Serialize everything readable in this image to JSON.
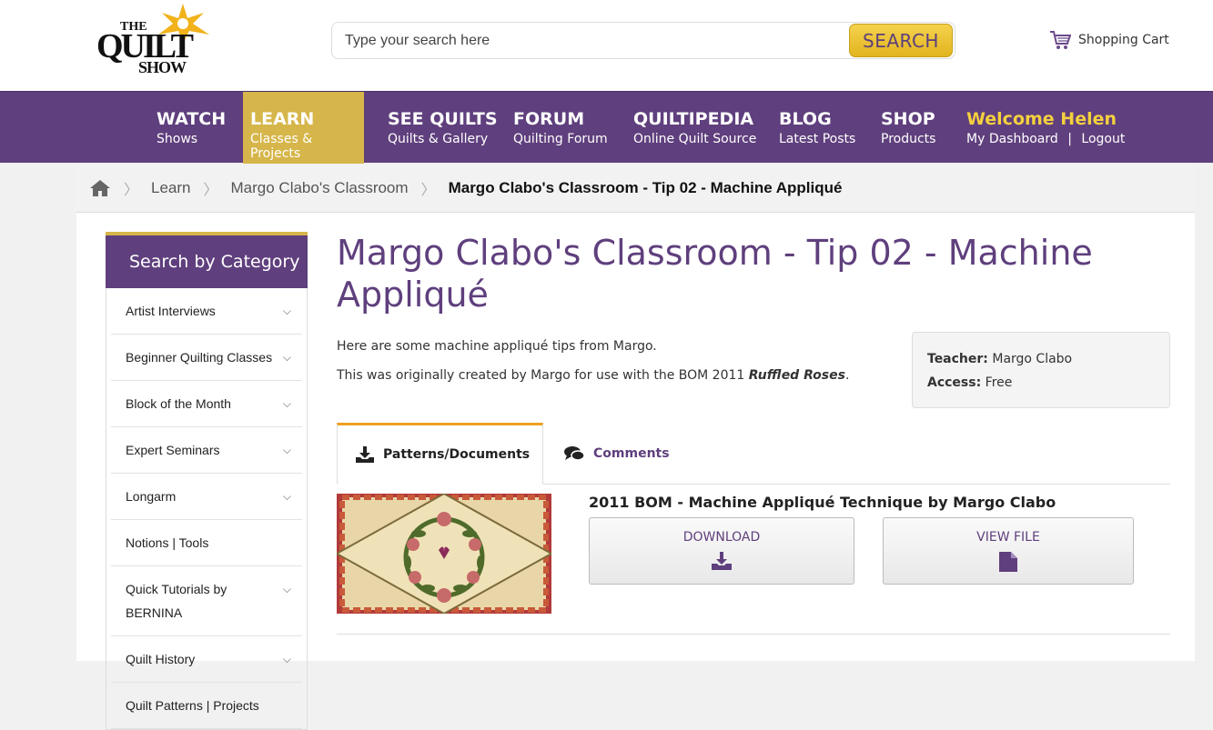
{
  "header": {
    "logo": {
      "the": "THE",
      "quilt": "QUILT",
      "show": "SHOW"
    },
    "search": {
      "placeholder": "Type your search here",
      "button": "SEARCH"
    },
    "cart_label": "Shopping Cart"
  },
  "nav": {
    "items": [
      {
        "title": "WATCH",
        "sub": "Shows"
      },
      {
        "title": "LEARN",
        "sub": "Classes & Projects"
      },
      {
        "title": "SEE QUILTS",
        "sub": "Quilts & Gallery"
      },
      {
        "title": "FORUM",
        "sub": "Quilting Forum"
      },
      {
        "title": "QUILTIPEDIA",
        "sub": "Online Quilt Source"
      },
      {
        "title": "BLOG",
        "sub": "Latest Posts"
      },
      {
        "title": "SHOP",
        "sub": "Products"
      }
    ],
    "welcome": {
      "title": "Welcome Helen",
      "dashboard": "My Dashboard",
      "separator": "|",
      "logout": "Logout"
    },
    "active_color": "#d6b64a",
    "bar_color": "#5f3f7d"
  },
  "breadcrumb": {
    "items": [
      "Learn",
      "Margo Clabo's Classroom"
    ],
    "current": "Margo Clabo's Classroom - Tip 02 - Machine Appliqué"
  },
  "sidebar": {
    "heading": "Search by Category",
    "items": [
      {
        "label": "Artist Interviews",
        "expandable": true
      },
      {
        "label": "Beginner Quilting Classes",
        "expandable": true
      },
      {
        "label": "Block of the Month",
        "expandable": true
      },
      {
        "label": "Expert Seminars",
        "expandable": true
      },
      {
        "label": "Longarm",
        "expandable": true
      },
      {
        "label": "Notions | Tools",
        "expandable": false
      },
      {
        "label": "Quick Tutorials by BERNINA",
        "expandable": true
      },
      {
        "label": "Quilt History",
        "expandable": true
      },
      {
        "label": "Quilt Patterns | Projects",
        "expandable": false
      }
    ]
  },
  "article": {
    "title": "Margo Clabo's Classroom - Tip 02 - Machine Appliqué",
    "intro1": "Here are some machine appliqué tips from Margo.",
    "intro2_prefix": "This was originally created by Margo for use with the BOM 2011 ",
    "intro2_em": "Ruffled Roses",
    "intro2_suffix": ".",
    "info": {
      "teacher_label": "Teacher:",
      "teacher": "Margo Clabo",
      "access_label": "Access:",
      "access": "Free"
    }
  },
  "tabs": {
    "patterns": "Patterns/Documents",
    "comments": "Comments"
  },
  "file": {
    "title": "2011 BOM - Machine Appliqué Technique by Margo Clabo",
    "download": "DOWNLOAD",
    "view": "VIEW FILE"
  }
}
